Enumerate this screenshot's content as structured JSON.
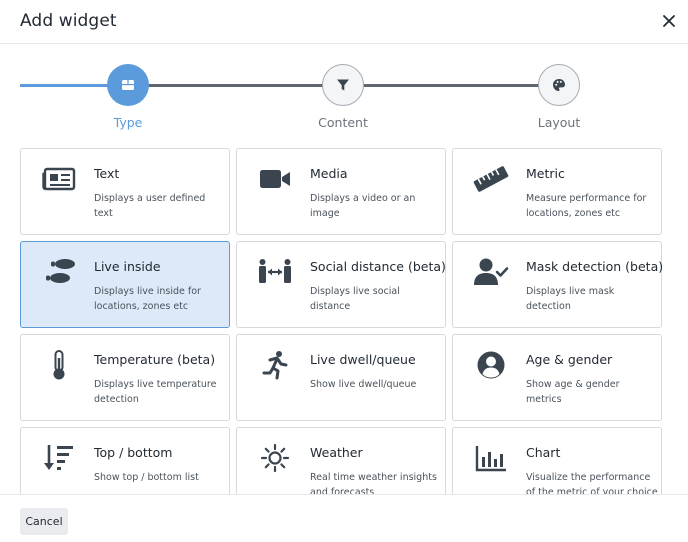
{
  "dialog": {
    "title": "Add widget",
    "close_icon": "close-icon"
  },
  "stepper": {
    "steps": [
      {
        "label": "Type",
        "icon": "box-icon",
        "state": "active"
      },
      {
        "label": "Content",
        "icon": "filter-icon",
        "state": "inactive"
      },
      {
        "label": "Layout",
        "icon": "palette-icon",
        "state": "inactive"
      }
    ],
    "colors": {
      "active": "#5b9bdb",
      "inactive": "#5f6670"
    }
  },
  "widgets": [
    {
      "title": "Text",
      "desc": "Displays a user defined text",
      "icon": "newspaper-icon"
    },
    {
      "title": "Media",
      "desc": "Displays a video or an image",
      "icon": "video-camera-icon"
    },
    {
      "title": "Metric",
      "desc": "Measure performance for locations, zones etc",
      "icon": "ruler-icon"
    },
    {
      "title": "Live inside",
      "desc": "Displays live inside for locations, zones etc",
      "icon": "footprints-icon",
      "selected": true
    },
    {
      "title": "Social distance (beta)",
      "desc": "Displays live social distance",
      "icon": "people-arrows-icon"
    },
    {
      "title": "Mask detection (beta)",
      "desc": "Displays live mask detection",
      "icon": "user-check-icon"
    },
    {
      "title": "Temperature (beta)",
      "desc": "Displays live temperature detection",
      "icon": "thermometer-icon"
    },
    {
      "title": "Live dwell/queue",
      "desc": "Show live dwell/queue",
      "icon": "running-person-icon"
    },
    {
      "title": "Age & gender",
      "desc": "Show age & gender metrics",
      "icon": "user-circle-icon"
    },
    {
      "title": "Top / bottom",
      "desc": "Show top / bottom list",
      "icon": "sort-amount-down-icon"
    },
    {
      "title": "Weather",
      "desc": "Real time weather insights and forecasts",
      "icon": "sun-icon"
    },
    {
      "title": "Chart",
      "desc": "Visualize the performance of the metric of your choice",
      "icon": "bar-chart-icon"
    }
  ],
  "footer": {
    "cancel_label": "Cancel"
  },
  "colors": {
    "selected_bg": "#dde9f8",
    "selected_border": "#5b9bdb",
    "icon": "#3b4550"
  }
}
